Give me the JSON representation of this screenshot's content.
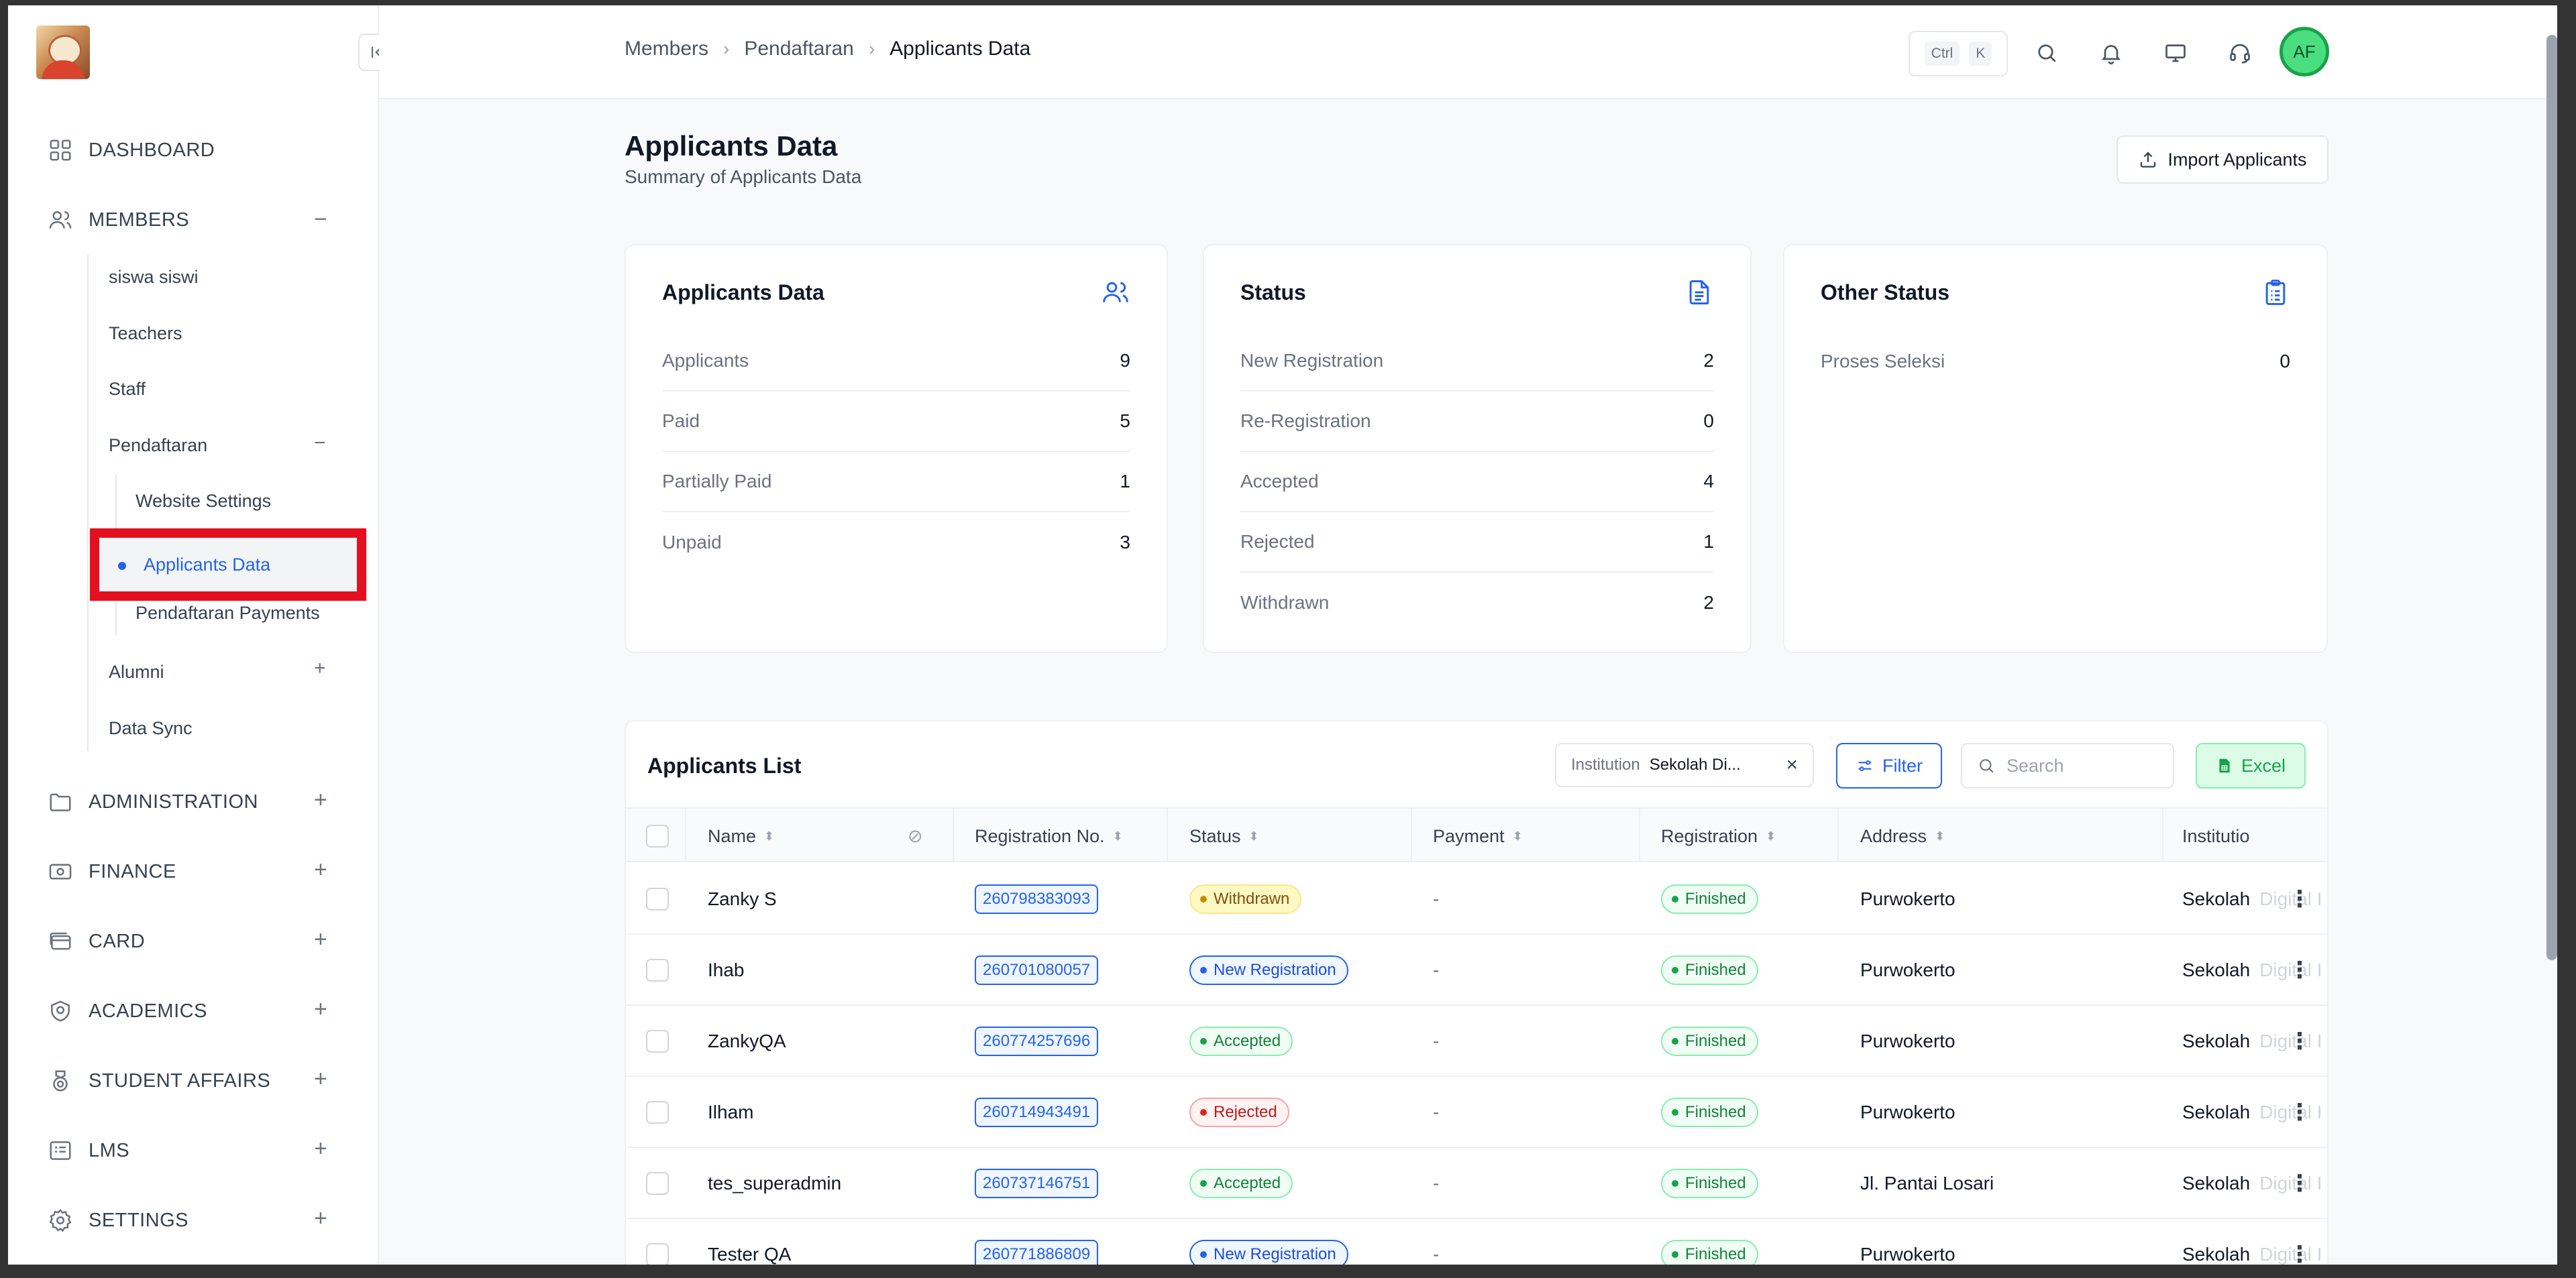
{
  "breadcrumb": {
    "items": [
      "Members",
      "Pendaftaran"
    ],
    "current": "Applicants Data"
  },
  "header": {
    "kbd_ctrl": "Ctrl",
    "kbd_k": "K",
    "avatar_initials": "AF"
  },
  "sidebar": {
    "dashboard": "DASHBOARD",
    "members": "MEMBERS",
    "members_toggle": "−",
    "sub": [
      "siswa siswi",
      "Teachers",
      "Staff",
      "Pendaftaran"
    ],
    "pendaftaran_toggle": "−",
    "pendaftaran_sub": [
      "Website Settings",
      "Applicants Data",
      "Pendaftaran Payments"
    ],
    "sub2": [
      "Alumni",
      "Data Sync"
    ],
    "alumni_toggle": "+",
    "groups": [
      "ADMINISTRATION",
      "FINANCE",
      "CARD",
      "ACADEMICS",
      "STUDENT AFFAIRS",
      "LMS",
      "SETTINGS"
    ],
    "plus": "+"
  },
  "page": {
    "title": "Applicants Data",
    "subtitle": "Summary of Applicants Data",
    "import_label": "Import Applicants"
  },
  "cards": {
    "applicants": {
      "title": "Applicants Data",
      "rows": [
        {
          "label": "Applicants",
          "value": "9"
        },
        {
          "label": "Paid",
          "value": "5"
        },
        {
          "label": "Partially Paid",
          "value": "1"
        },
        {
          "label": "Unpaid",
          "value": "3"
        }
      ]
    },
    "status": {
      "title": "Status",
      "rows": [
        {
          "label": "New Registration",
          "value": "2"
        },
        {
          "label": "Re-Registration",
          "value": "0"
        },
        {
          "label": "Accepted",
          "value": "4"
        },
        {
          "label": "Rejected",
          "value": "1"
        },
        {
          "label": "Withdrawn",
          "value": "2"
        }
      ]
    },
    "other": {
      "title": "Other Status",
      "rows": [
        {
          "label": "Proses Seleksi",
          "value": "0"
        }
      ]
    }
  },
  "list": {
    "title": "Applicants List",
    "institution_key": "Institution",
    "institution_value": "Sekolah Di...",
    "filter_label": "Filter",
    "search_placeholder": "Search",
    "excel_label": "Excel",
    "columns": [
      "Name",
      "Registration No.",
      "Status",
      "Payment",
      "Registration",
      "Address",
      "Institutio"
    ],
    "rows": [
      {
        "name": "Zanky S",
        "reg": "260798383093",
        "status": "Withdrawn",
        "status_kind": "withdrawn",
        "payment": "-",
        "registration": "Finished",
        "address": "Purwokerto",
        "inst": "Sekolah",
        "inst_faded": "Digital I"
      },
      {
        "name": "Ihab",
        "reg": "260701080057",
        "status": "New Registration",
        "status_kind": "newreg",
        "payment": "-",
        "registration": "Finished",
        "address": "Purwokerto",
        "inst": "Sekolah",
        "inst_faded": "Digital I"
      },
      {
        "name": "ZankyQA",
        "reg": "260774257696",
        "status": "Accepted",
        "status_kind": "accepted",
        "payment": "-",
        "registration": "Finished",
        "address": "Purwokerto",
        "inst": "Sekolah",
        "inst_faded": "Digital I"
      },
      {
        "name": "Ilham",
        "reg": "260714943491",
        "status": "Rejected",
        "status_kind": "rejected",
        "payment": "-",
        "registration": "Finished",
        "address": "Purwokerto",
        "inst": "Sekolah",
        "inst_faded": "Digital I"
      },
      {
        "name": "tes_superadmin",
        "reg": "260737146751",
        "status": "Accepted",
        "status_kind": "accepted",
        "payment": "-",
        "registration": "Finished",
        "address": "Jl. Pantai Losari",
        "inst": "Sekolah",
        "inst_faded": "Digital I"
      },
      {
        "name": "Tester QA",
        "reg": "260771886809",
        "status": "New Registration",
        "status_kind": "newreg",
        "payment": "-",
        "registration": "Finished",
        "address": "Purwokerto",
        "inst": "Sekolah",
        "inst_faded": "Digital I"
      }
    ]
  },
  "colors": {
    "accent": "#2563eb",
    "highlight_box": "#e4101f",
    "success": "#16a34a"
  }
}
